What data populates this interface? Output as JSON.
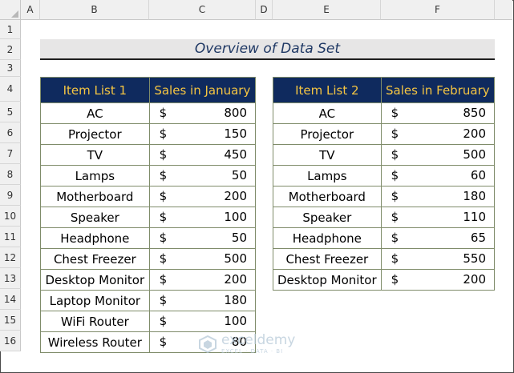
{
  "sheet": {
    "columns": [
      "A",
      "B",
      "C",
      "D",
      "E",
      "F"
    ],
    "rows": [
      "1",
      "2",
      "3",
      "4",
      "5",
      "6",
      "7",
      "8",
      "9",
      "10",
      "11",
      "12",
      "13",
      "14",
      "15",
      "16"
    ]
  },
  "title": "Overview of Data Set",
  "table1": {
    "headers": [
      "Item List 1",
      "Sales in January"
    ],
    "rows": [
      {
        "item": "AC",
        "cur": "$",
        "value": "800"
      },
      {
        "item": "Projector",
        "cur": "$",
        "value": "150"
      },
      {
        "item": "TV",
        "cur": "$",
        "value": "450"
      },
      {
        "item": "Lamps",
        "cur": "$",
        "value": "50"
      },
      {
        "item": "Motherboard",
        "cur": "$",
        "value": "200"
      },
      {
        "item": "Speaker",
        "cur": "$",
        "value": "100"
      },
      {
        "item": "Headphone",
        "cur": "$",
        "value": "50"
      },
      {
        "item": "Chest Freezer",
        "cur": "$",
        "value": "500"
      },
      {
        "item": "Desktop Monitor",
        "cur": "$",
        "value": "200"
      },
      {
        "item": "Laptop Monitor",
        "cur": "$",
        "value": "180"
      },
      {
        "item": "WiFi Router",
        "cur": "$",
        "value": "100"
      },
      {
        "item": "Wireless Router",
        "cur": "$",
        "value": "80"
      }
    ]
  },
  "table2": {
    "headers": [
      "Item List 2",
      "Sales in February"
    ],
    "rows": [
      {
        "item": "AC",
        "cur": "$",
        "value": "850"
      },
      {
        "item": "Projector",
        "cur": "$",
        "value": "200"
      },
      {
        "item": "TV",
        "cur": "$",
        "value": "500"
      },
      {
        "item": "Lamps",
        "cur": "$",
        "value": "60"
      },
      {
        "item": "Motherboard",
        "cur": "$",
        "value": "180"
      },
      {
        "item": "Speaker",
        "cur": "$",
        "value": "110"
      },
      {
        "item": "Headphone",
        "cur": "$",
        "value": "65"
      },
      {
        "item": "Chest Freezer",
        "cur": "$",
        "value": "550"
      },
      {
        "item": "Desktop Monitor",
        "cur": "$",
        "value": "200"
      }
    ]
  },
  "watermark": {
    "name": "exceldemy",
    "tagline": "EXCEL · DATA · BI"
  },
  "colors": {
    "header_bg": "#0f2a5e",
    "header_text": "#f5c542",
    "title_text": "#1f3864",
    "title_band": "#e7e6e6",
    "border": "#7f8c6a"
  }
}
